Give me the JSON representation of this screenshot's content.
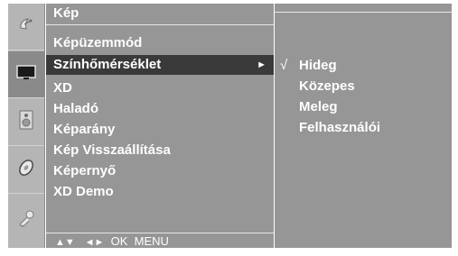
{
  "menu": {
    "title": "Kép",
    "items": [
      {
        "label": "Képüzemmód"
      },
      {
        "label": "Színhőmérséklet",
        "arrow": "►"
      },
      {
        "label": "XD"
      },
      {
        "label": "Haladó"
      },
      {
        "label": "Képarány"
      },
      {
        "label": "Kép Visszaállítása"
      },
      {
        "label": "Képernyő"
      },
      {
        "label": "XD Demo"
      }
    ],
    "selected_index": 1,
    "footer": {
      "updown": "▲▼",
      "leftright": "◄►",
      "ok": "OK",
      "menu": "MENU"
    }
  },
  "submenu": {
    "check_mark": "√",
    "items": [
      {
        "label": "Hideg",
        "checked": true
      },
      {
        "label": "Közepes"
      },
      {
        "label": "Meleg"
      },
      {
        "label": "Felhasználói"
      }
    ]
  },
  "icons": [
    "satellite-dish-icon",
    "screen-icon",
    "speaker-icon",
    "disc-icon",
    "key-icon"
  ],
  "colors": {
    "panel": "#969696",
    "icon_column": "#b5b5b5",
    "highlight": "#3a3a3a",
    "text": "#ffffff"
  }
}
